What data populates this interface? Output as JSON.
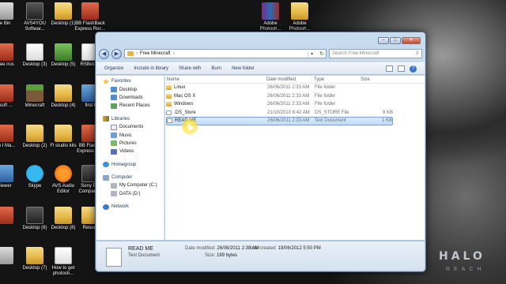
{
  "desktop": {
    "icons": [
      {
        "label": "le Bin",
        "kind": "app-grey"
      },
      {
        "label": "AVS4YOU Softwar...",
        "kind": "app-dark"
      },
      {
        "label": "Desktop (1)",
        "kind": "folder"
      },
      {
        "label": "BB FlashBack Express Rec...",
        "kind": "app-red"
      },
      {
        "label": "Free irus",
        "kind": "app-red"
      },
      {
        "label": "Desktop (3)",
        "kind": "doc"
      },
      {
        "label": "Desktop (5)",
        "kind": "app-green"
      },
      {
        "label": "RSBot-4(",
        "kind": "doc"
      },
      {
        "label": "osoft ...",
        "kind": "app-red"
      },
      {
        "label": "Minecraft",
        "kind": "minecraft"
      },
      {
        "label": "Desktop (4)",
        "kind": "folder"
      },
      {
        "label": "first t",
        "kind": "app-blue"
      },
      {
        "label": "ton t Ma...",
        "kind": "app-red"
      },
      {
        "label": "Desktop (2)",
        "kind": "folder"
      },
      {
        "label": "Fl studio kits",
        "kind": "folder"
      },
      {
        "label": "BB FlashB Express Pl...",
        "kind": "app-red"
      },
      {
        "label": "viewer",
        "kind": "app-blue"
      },
      {
        "label": "Skype",
        "kind": "skype"
      },
      {
        "label": "AVS Audio Editor",
        "kind": "avs"
      },
      {
        "label": "Sony Pic Compani...",
        "kind": "app-dark"
      },
      {
        "label": "",
        "kind": "app-red"
      },
      {
        "label": "Desktop (6)",
        "kind": "app-dark"
      },
      {
        "label": "Desktop (8)",
        "kind": "folder"
      },
      {
        "label": "Resum",
        "kind": "folder"
      },
      {
        "label": "",
        "kind": "app-grey"
      },
      {
        "label": "Desktop (7)",
        "kind": "folder"
      },
      {
        "label": "How to get photosh...",
        "kind": "doc"
      },
      {
        "label": "Adobe Photosh...",
        "kind": "winrar"
      },
      {
        "label": "Adobe Photosh...",
        "kind": "folder"
      }
    ],
    "wallpaper_text": "HALO",
    "wallpaper_subtext": "REACH"
  },
  "window": {
    "address": {
      "location": "Free Minecraft",
      "search_placeholder": "Search Free Minecraft"
    },
    "toolbar": {
      "organize": "Organize",
      "include_in_library": "Include in library",
      "share_with": "Share with",
      "burn": "Burn",
      "new_folder": "New folder"
    },
    "nav": {
      "favorites": "Favorites",
      "desktop": "Desktop",
      "downloads": "Downloads",
      "recent_places": "Recent Places",
      "libraries": "Libraries",
      "documents": "Documents",
      "music": "Music",
      "pictures": "Pictures",
      "videos": "Videos",
      "homegroup": "Homegroup",
      "computer": "Computer",
      "drive_c": "My Computer (C:)",
      "drive_d": "DATA (D:)",
      "network": "Network"
    },
    "columns": {
      "name": "Name",
      "date_modified": "Date modified",
      "type": "Type",
      "size": "Size"
    },
    "files": [
      {
        "name": "Linux",
        "date": "26/06/2011 2:33 AM",
        "type": "File folder",
        "size": "",
        "kind": "folder"
      },
      {
        "name": "Mac OS X",
        "date": "26/06/2011 2:33 AM",
        "type": "File folder",
        "size": "",
        "kind": "folder"
      },
      {
        "name": "Windows",
        "date": "26/06/2011 2:33 AM",
        "type": "File folder",
        "size": "",
        "kind": "folder"
      },
      {
        "name": ".DS_Store",
        "date": "21/10/2010 6:42 AM",
        "type": "DS_STORE File",
        "size": "9 KB",
        "kind": "file"
      },
      {
        "name": "READ ME",
        "date": "26/06/2011 2:33 AM",
        "type": "Text Document",
        "size": "1 KB",
        "kind": "file"
      }
    ],
    "selected_file": "READ ME",
    "details": {
      "name": "READ ME",
      "type": "Text Document",
      "modified_label": "Date modified:",
      "modified_value": "26/06/2011 2:33 AM",
      "size_label": "Size:",
      "size_value": "189 bytes",
      "created_label": "Date created:",
      "created_value": "19/06/2012 5:50 PM"
    }
  }
}
